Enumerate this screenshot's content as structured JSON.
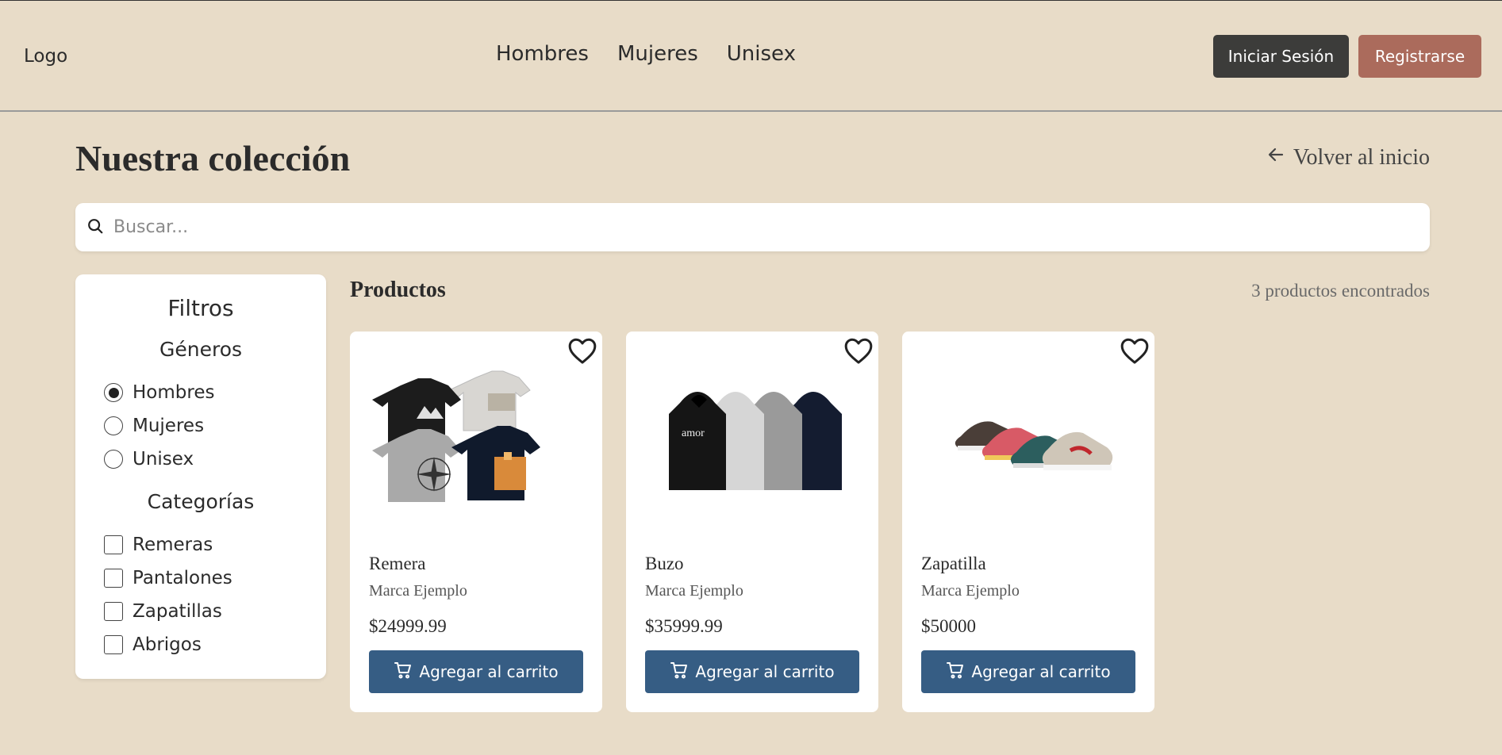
{
  "header": {
    "logo": "Logo",
    "nav": [
      "Hombres",
      "Mujeres",
      "Unisex"
    ],
    "login_label": "Iniciar Sesión",
    "register_label": "Registrarse"
  },
  "page": {
    "title": "Nuestra colección",
    "back_label": "Volver al inicio"
  },
  "search": {
    "placeholder": "Buscar..."
  },
  "filters": {
    "title": "Filtros",
    "genres_title": "Géneros",
    "genres": [
      "Hombres",
      "Mujeres",
      "Unisex"
    ],
    "selected_genre": "Hombres",
    "categories_title": "Categorías",
    "categories": [
      "Remeras",
      "Pantalones",
      "Zapatillas",
      "Abrigos"
    ]
  },
  "products": {
    "title": "Productos",
    "count_label": "3 productos encontrados",
    "add_label": "Agregar al carrito",
    "items": [
      {
        "name": "Remera",
        "brand": "Marca Ejemplo",
        "price": "$24999.99",
        "image": "tshirts-image"
      },
      {
        "name": "Buzo",
        "brand": "Marca Ejemplo",
        "price": "$35999.99",
        "image": "hoodies-image"
      },
      {
        "name": "Zapatilla",
        "brand": "Marca Ejemplo",
        "price": "$50000",
        "image": "sneakers-image"
      }
    ]
  },
  "colors": {
    "background": "#e8dcc8",
    "login_button": "#3c3c3a",
    "register_button": "#ab6b5c",
    "cart_button": "#365d84"
  }
}
